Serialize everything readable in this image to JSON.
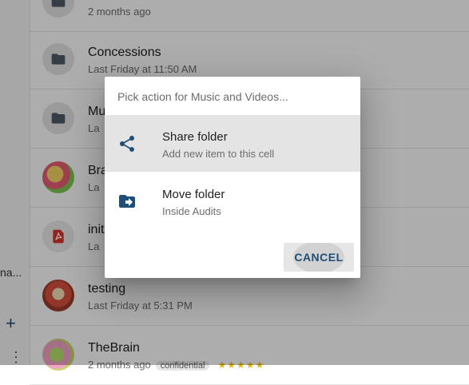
{
  "rail": {
    "truncated_label": "na...",
    "add_symbol": "+",
    "more_symbol": "⋮"
  },
  "list": {
    "items": [
      {
        "title": "",
        "subtitle": "2 months ago",
        "icon": "folder-icon"
      },
      {
        "title": "Concessions",
        "subtitle": "Last Friday at 11:50 AM",
        "icon": "folder-icon"
      },
      {
        "title": "Mu",
        "subtitle": "La",
        "icon": "folder-icon"
      },
      {
        "title": "Bra",
        "subtitle": "La",
        "icon": "image-thumbnail"
      },
      {
        "title": "init",
        "subtitle": "La",
        "icon": "pdf-icon"
      },
      {
        "title": "testing",
        "subtitle": "Last Friday at 5:31 PM",
        "icon": "image-thumbnail"
      },
      {
        "title": "TheBrain",
        "subtitle": "2 months ago",
        "tag": "confidential",
        "stars": "★★★★★",
        "icon": "image-thumbnail"
      }
    ]
  },
  "dialog": {
    "title": "Pick action for Music and Videos...",
    "actions": [
      {
        "label": "Share folder",
        "description": "Add new item to this cell",
        "icon": "share-icon",
        "selected": true
      },
      {
        "label": "Move folder",
        "description": "Inside Audits",
        "icon": "move-folder-icon",
        "selected": false
      }
    ],
    "cancel_label": "CANCEL"
  },
  "colors": {
    "accent": "#1f4e79",
    "icon": "#1f4e79",
    "folder": "#4f5b66",
    "selected_row": "#e4e4e4"
  }
}
